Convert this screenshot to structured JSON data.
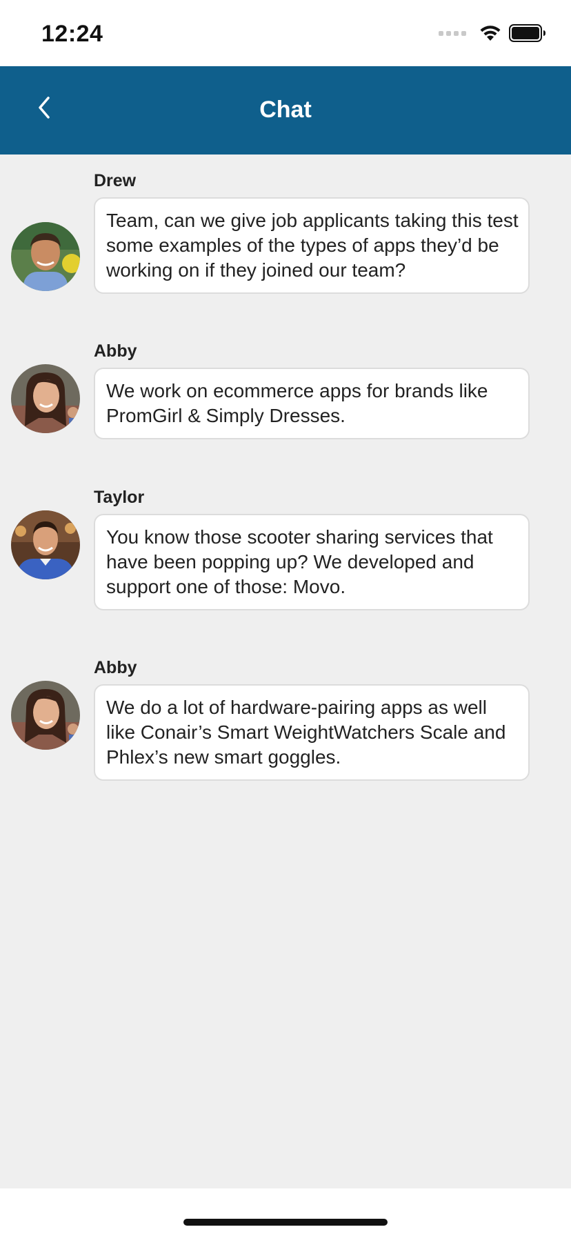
{
  "status_bar": {
    "time": "12:24"
  },
  "header": {
    "title": "Chat",
    "back_icon": "chevron-left-icon",
    "background_color": "#0f5f8c"
  },
  "messages": [
    {
      "sender": "Drew",
      "text": "Team, can we give job applicants taking this test some examples of the types of apps they’d be working on if they joined our team?",
      "avatar": "drew-avatar"
    },
    {
      "sender": "Abby",
      "text": "We work on ecommerce apps for brands like PromGirl & Simply Dresses.",
      "avatar": "abby-avatar"
    },
    {
      "sender": "Taylor",
      "text": "You know those scooter sharing services that have been popping up? We developed and support one of those: Movo.",
      "avatar": "taylor-avatar"
    },
    {
      "sender": "Abby",
      "text": "We do a lot of hardware-pairing apps as well like Conair’s Smart WeightWatchers Scale and Phlex’s new smart goggles.",
      "avatar": "abby-avatar"
    }
  ]
}
